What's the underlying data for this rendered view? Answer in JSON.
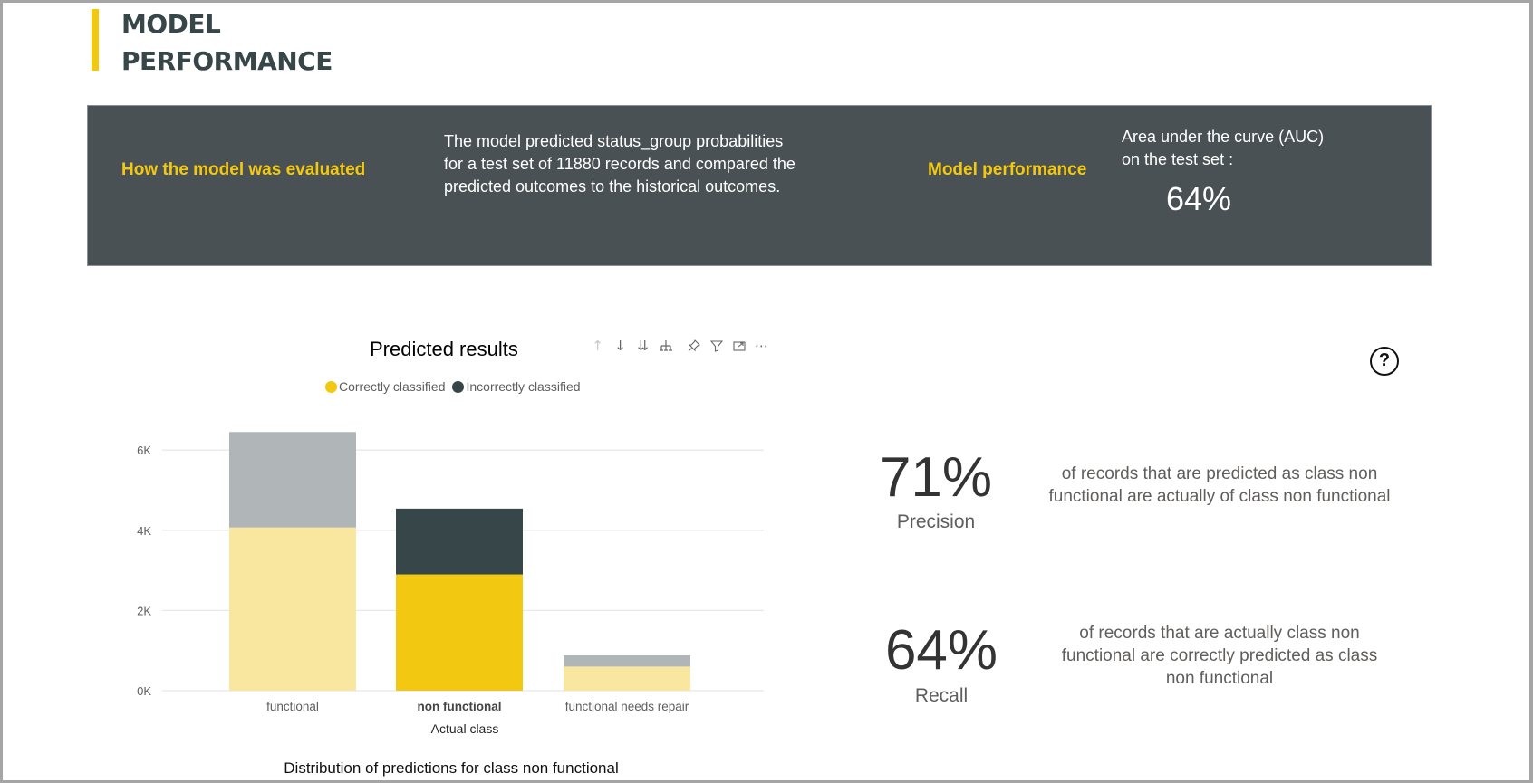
{
  "header": {
    "title_line1": "MODEL",
    "title_line2": "PERFORMANCE",
    "accent_color": "#f2c811"
  },
  "banner": {
    "evaluation_label": "How the model was evaluated",
    "evaluation_text_lines": [
      "The model predicted status_group probabilities",
      "for a test set of 11880 records and compared the",
      "predicted outcomes to the historical outcomes."
    ],
    "performance_label": "Model performance",
    "auc_text_lines": [
      "Area under the curve (AUC)",
      "on the test set :"
    ],
    "auc_value": "64%"
  },
  "visual": {
    "title": "Predicted results",
    "toolbar": [
      {
        "name": "drill-up-icon",
        "glyph": "↑",
        "enabled": false
      },
      {
        "name": "drill-down-icon",
        "glyph": "↓",
        "enabled": true
      },
      {
        "name": "next-level-icon",
        "glyph": "⇊",
        "enabled": true
      },
      {
        "name": "expand-hierarchy-icon",
        "glyph": "⏚",
        "enabled": true
      },
      {
        "name": "pin-icon",
        "glyph": "📌",
        "enabled": true
      },
      {
        "name": "filter-icon",
        "glyph": "▽",
        "enabled": true
      },
      {
        "name": "focus-mode-icon",
        "glyph": "⧉",
        "enabled": true
      },
      {
        "name": "more-options-icon",
        "glyph": "⋯",
        "enabled": true
      }
    ],
    "caption": "Distribution of predictions for class non functional"
  },
  "chart_data": {
    "type": "bar",
    "stacked": true,
    "title": "Predicted results",
    "xlabel": "Actual class",
    "ylabel": "",
    "categories": [
      "functional",
      "non functional",
      "functional needs repair"
    ],
    "selected_category": "non functional",
    "series": [
      {
        "name": "Correctly classified",
        "values": [
          4070,
          2900,
          600
        ],
        "color": "#f2c811"
      },
      {
        "name": "Incorrectly classified",
        "values": [
          2380,
          1640,
          280
        ],
        "color": "#374649"
      }
    ],
    "yticks": [
      "0K",
      "2K",
      "4K",
      "6K"
    ],
    "ytick_values": [
      0,
      2000,
      4000,
      6000
    ],
    "ylim": [
      0,
      6600
    ],
    "grid": true,
    "legend_position": "top"
  },
  "metrics": {
    "precision": {
      "value": "71%",
      "label": "Precision",
      "description_lines": [
        "of records that are predicted as class non",
        "functional are actually of class non functional"
      ]
    },
    "recall": {
      "value": "64%",
      "label": "Recall",
      "description_lines": [
        "of records that are actually class non",
        "functional are correctly predicted as class",
        "non functional"
      ]
    }
  },
  "help": {
    "glyph": "?"
  }
}
